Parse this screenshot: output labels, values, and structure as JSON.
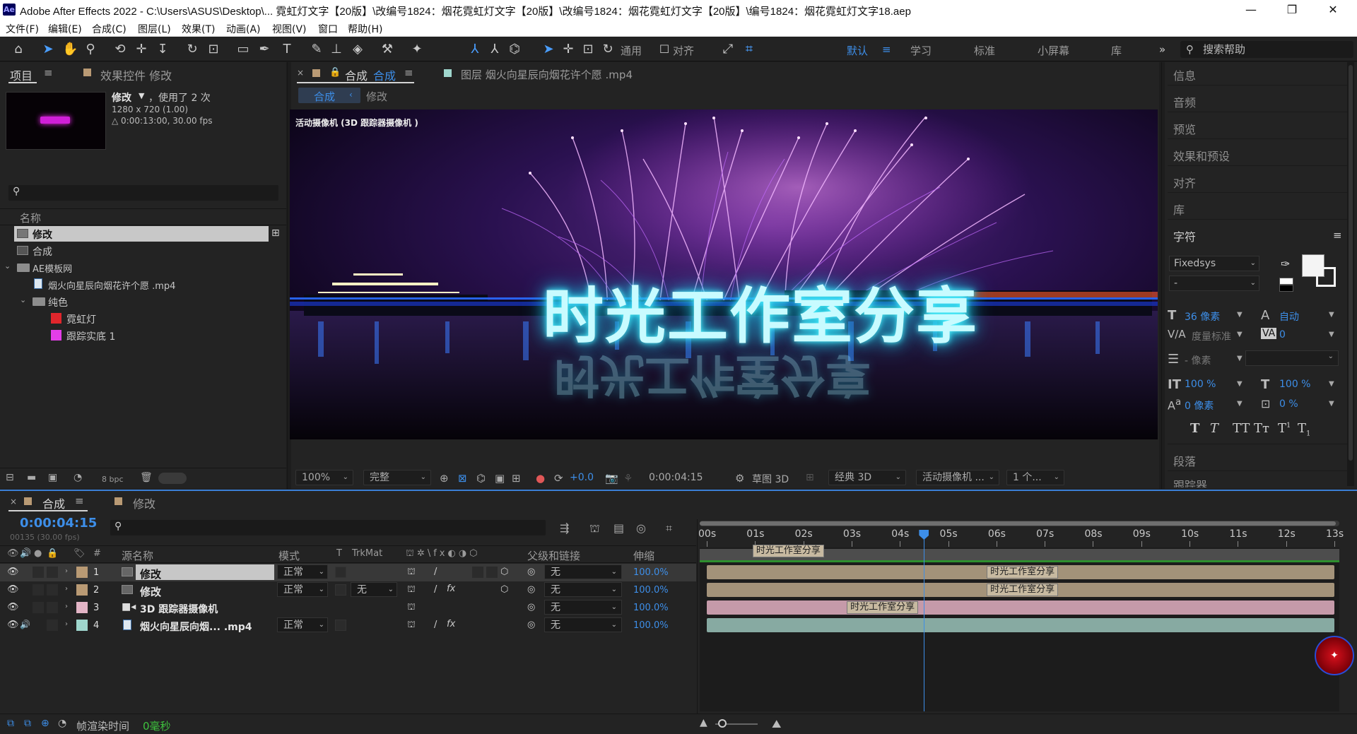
{
  "window": {
    "title": "Adobe After Effects 2022 - C:\\Users\\ASUS\\Desktop\\... 霓虹灯文字【20版】\\改编号1824：烟花霓虹灯文字【20版】\\改编号1824：烟花霓虹灯文字【20版】\\编号1824：烟花霓虹灯文字18.aep",
    "app_icon": "Ae",
    "minimize": "—",
    "maximize": "❐",
    "close": "✕"
  },
  "menu": [
    "文件(F)",
    "编辑(E)",
    "合成(C)",
    "图层(L)",
    "效果(T)",
    "动画(A)",
    "视图(V)",
    "窗口",
    "帮助(H)"
  ],
  "toolbar": {
    "universal_label": "通用",
    "align_label": "对齐",
    "workspaces": [
      "默认",
      "学习",
      "标准",
      "小屏幕",
      "库"
    ],
    "active_workspace": "默认",
    "more": "»",
    "search_placeholder": "搜索帮助"
  },
  "project": {
    "tab_project": "项目",
    "tab_effects": "效果控件 修改",
    "selected_name": "修改",
    "used_text": "，使用了 2 次",
    "resolution": "1280 x 720 (1.00)",
    "duration": "△ 0:00:13:00, 30.00 fps",
    "column_name": "名称",
    "items": [
      {
        "name": "修改",
        "type": "comp",
        "selected": true
      },
      {
        "name": "合成",
        "type": "comp"
      },
      {
        "name": "AE模板网",
        "type": "folder"
      },
      {
        "name": "烟火向星辰向烟花许个愿 .mp4",
        "type": "file"
      },
      {
        "name": "纯色",
        "type": "folder"
      },
      {
        "name": "霓虹灯",
        "type": "solid",
        "color": "#e0262c"
      },
      {
        "name": "跟踪实底 1",
        "type": "solid",
        "color": "#e43ee8"
      }
    ],
    "bpc": "8 bpc"
  },
  "viewer": {
    "tab_comp_label": "合成",
    "tab_comp_name": "合成",
    "tab_layer": "图层 烟火向星辰向烟花许个愿 .mp4",
    "breadcrumb": [
      "合成",
      "修改"
    ],
    "camera_label": "活动摄像机 (3D 跟踪器摄像机 )",
    "overlay_text": "时光工作室分享",
    "zoom": "100%",
    "quality": "完整",
    "exposure": "+0.0",
    "timecode": "0:00:04:15",
    "draft3d": "草图 3D",
    "renderer": "经典 3D",
    "camera": "活动摄像机 ...",
    "views": "1 个..."
  },
  "right_panel": {
    "sections": [
      "信息",
      "音频",
      "预览",
      "效果和预设",
      "对齐",
      "库"
    ],
    "character": "字符",
    "font": "Fixedsys",
    "font_style": "-",
    "font_size": "36 像素",
    "leading": "自动",
    "kerning": "度量标准",
    "tracking": "0",
    "stroke": "- 像素",
    "vscale": "100 %",
    "hscale": "100 %",
    "baseline": "0 像素",
    "tsume": "0 %",
    "paragraph": "段落",
    "tracker": "跟踪器"
  },
  "timeline": {
    "tab_comp": "合成",
    "tab_modify": "修改",
    "timecode": "0:00:04:15",
    "frame_info": "00135 (30.00 fps)",
    "columns": {
      "source": "源名称",
      "mode": "模式",
      "t": "T",
      "trkmat": "TrkMat",
      "parent": "父级和链接",
      "stretch": "伸缩",
      "num": "#"
    },
    "ticks": [
      "00s",
      "01s",
      "02s",
      "03s",
      "04s",
      "05s",
      "06s",
      "07s",
      "08s",
      "09s",
      "10s",
      "11s",
      "12s",
      "13s"
    ],
    "current_time_sec": 4.5,
    "duration_sec": 13,
    "work_marker": "时光工作室分享",
    "layers": [
      {
        "num": "1",
        "name": "修改",
        "mode": "正常",
        "trkmat": "",
        "parent": "无",
        "stretch": "100.0%",
        "color": "#b99a74",
        "bar_color": "#a39279",
        "marker": "时光工作室分享",
        "marker_sec": 5.8,
        "selected": true
      },
      {
        "num": "2",
        "name": "修改",
        "mode": "正常",
        "trkmat": "无",
        "parent": "无",
        "stretch": "100.0%",
        "color": "#b99a74",
        "bar_color": "#a39279",
        "marker": "时光工作室分享",
        "marker_sec": 5.8
      },
      {
        "num": "3",
        "name": "3D 跟踪器摄像机",
        "mode": "",
        "trkmat": "",
        "parent": "无",
        "stretch": "100.0%",
        "color": "#e3b5c6",
        "bar_color": "#c59aa9",
        "marker": "时光工作室分享",
        "marker_sec": 2.9
      },
      {
        "num": "4",
        "name": "烟火向星辰向烟... .mp4",
        "mode": "正常",
        "trkmat": "",
        "parent": "无",
        "stretch": "100.0%",
        "color": "#9fd6cd",
        "bar_color": "#87aaa2",
        "marker": "",
        "marker_sec": 0
      }
    ]
  },
  "status": {
    "render_label": "帧渲染时间",
    "render_value": "0毫秒"
  },
  "colors": {
    "accent": "#3d8ee8",
    "panel": "#232323",
    "bg": "#1d1d1d"
  }
}
